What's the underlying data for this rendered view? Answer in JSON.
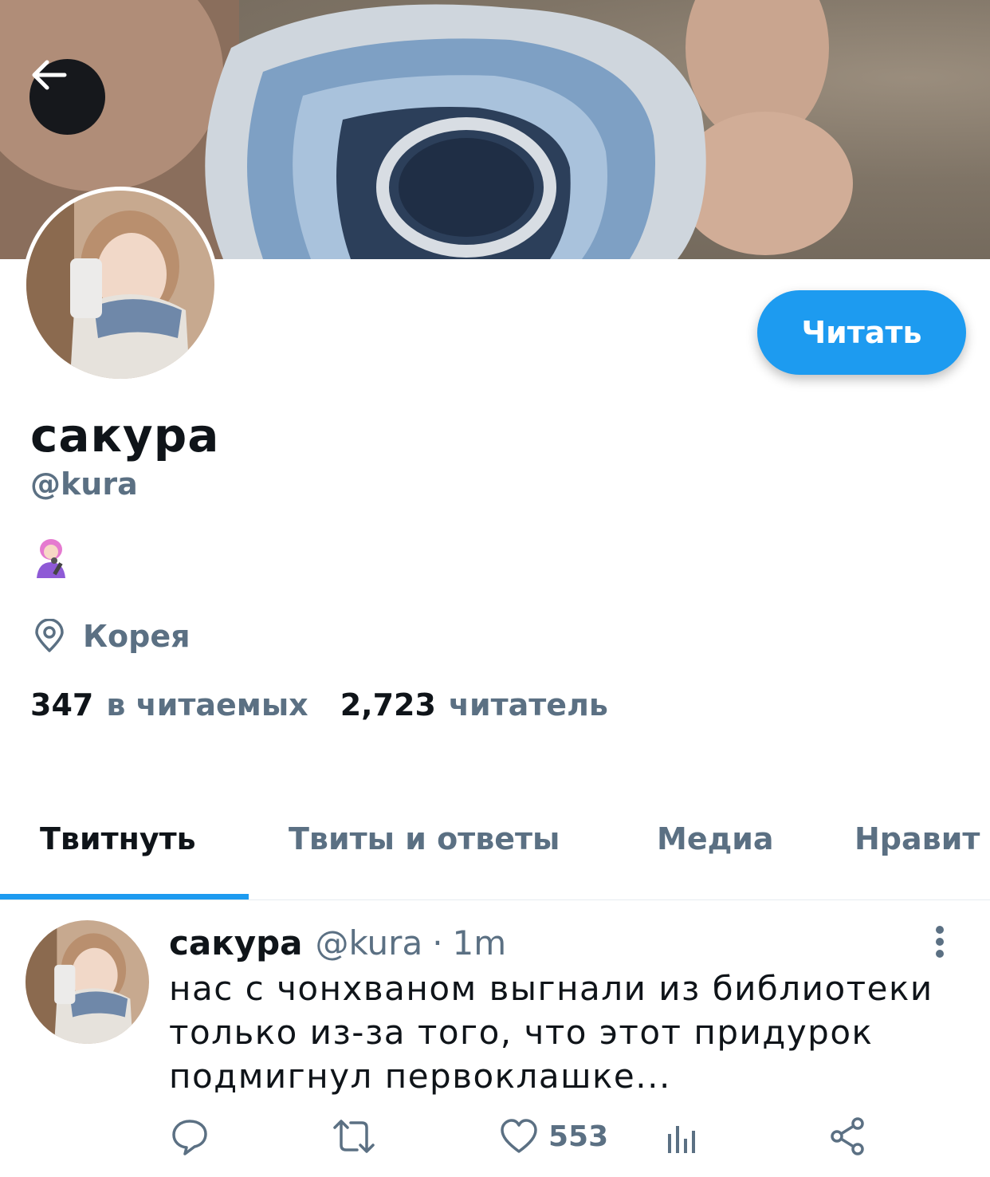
{
  "header": {
    "back_icon": "arrow-left-icon"
  },
  "profile": {
    "name": "сакура",
    "handle": "@kura",
    "bio_icon": "woman-singer-emoji",
    "location_icon": "location-pin-icon",
    "location": "Корея",
    "following_count": "347",
    "following_label": "в читаемых",
    "followers_count": "2,723",
    "followers_label": "читатель",
    "follow_button": "Читать"
  },
  "tabs": [
    {
      "label": "Твитнуть",
      "active": true
    },
    {
      "label": "Твиты и ответы",
      "active": false
    },
    {
      "label": "Медиа",
      "active": false
    },
    {
      "label": "Нравит",
      "active": false
    }
  ],
  "tweet": {
    "name": "сакура",
    "handle": "@kura",
    "separator": "·",
    "time": "1m",
    "text": "нас с чонхваном выгнали из библиотеки только из-за того, что этот придурок подмигнул первоклашке...",
    "likes": "553",
    "actions": [
      "reply-icon",
      "retweet-icon",
      "like-icon",
      "analytics-icon",
      "share-icon"
    ]
  },
  "colors": {
    "accent": "#1d9bf0",
    "secondary_text": "#5b7083",
    "primary_text": "#0f1419"
  }
}
